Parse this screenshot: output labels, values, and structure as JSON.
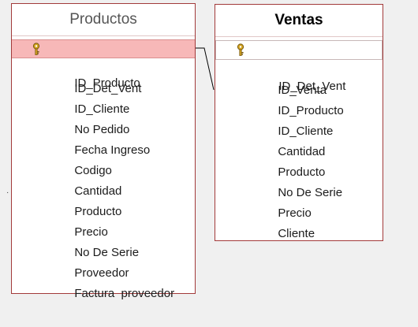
{
  "productos": {
    "title": "Productos",
    "fields": [
      {
        "label": "ID_Producto",
        "key": true
      },
      {
        "label": "ID_Det_Vent",
        "key": false
      },
      {
        "label": "ID_Cliente",
        "key": false
      },
      {
        "label": "No Pedido",
        "key": false
      },
      {
        "label": "Fecha Ingreso",
        "key": false
      },
      {
        "label": "Codigo",
        "key": false
      },
      {
        "label": "Cantidad",
        "key": false
      },
      {
        "label": "Producto",
        "key": false
      },
      {
        "label": "Precio",
        "key": false
      },
      {
        "label": "No De Serie",
        "key": false
      },
      {
        "label": "Proveedor",
        "key": false
      },
      {
        "label": "Factura  proveedor",
        "key": false
      }
    ]
  },
  "ventas": {
    "title": "Ventas",
    "fields": [
      {
        "label": "ID_Det_Vent",
        "key": true
      },
      {
        "label": "ID_Venta",
        "key": false
      },
      {
        "label": "ID_Producto",
        "key": false
      },
      {
        "label": "ID_Cliente",
        "key": false
      },
      {
        "label": "Cantidad",
        "key": false
      },
      {
        "label": "Producto",
        "key": false
      },
      {
        "label": "No De Serie",
        "key": false
      },
      {
        "label": "Precio",
        "key": false
      },
      {
        "label": "Cliente",
        "key": false
      }
    ]
  },
  "colors": {
    "border": "#a23a3a",
    "selected_row": "#f7b8b8",
    "background": "#f0f0f0",
    "key_icon": "#d4a520"
  },
  "icons": {
    "primary_key": "key-icon"
  }
}
